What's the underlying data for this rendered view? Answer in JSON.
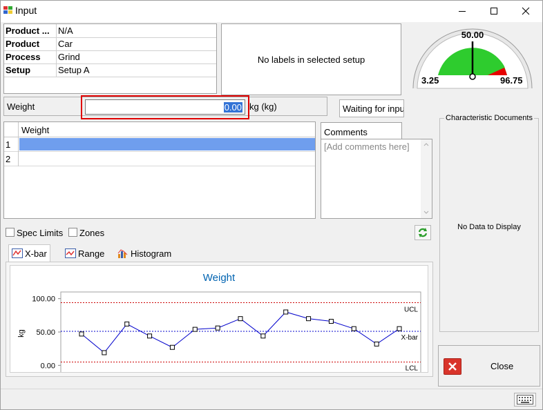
{
  "window": {
    "title": "Input"
  },
  "info": {
    "rows": [
      {
        "key": "Product ...",
        "value": "N/A"
      },
      {
        "key": "Product",
        "value": "Car"
      },
      {
        "key": "Process",
        "value": "Grind"
      },
      {
        "key": "Setup",
        "value": "Setup A"
      }
    ]
  },
  "labels_box": {
    "text": "No labels in selected setup"
  },
  "gauge": {
    "value": "50.00",
    "min": "3.25",
    "max": "96.75"
  },
  "weight_input": {
    "label": "Weight",
    "value": "0.00",
    "unit": "kg (kg)"
  },
  "status": {
    "text": "Waiting for inpu"
  },
  "grid": {
    "header": "Weight",
    "rows": [
      "1",
      "2"
    ]
  },
  "comments": {
    "tab": "Comments",
    "placeholder": "[Add comments here]"
  },
  "options": {
    "spec_limits": "Spec Limits",
    "zones": "Zones"
  },
  "tabs": {
    "xbar": "X-bar",
    "range": "Range",
    "histogram": "Histogram"
  },
  "chart_data": {
    "type": "line",
    "title": "Weight",
    "ylabel": "kg",
    "ylim": [
      -10,
      110
    ],
    "yticks": [
      "100.00",
      "50.00",
      "0.00"
    ],
    "ytick_values": [
      100,
      50,
      0
    ],
    "series": [
      {
        "values": [
          47,
          19,
          62,
          44,
          27,
          54,
          56,
          70,
          44,
          80,
          70,
          66,
          55,
          32,
          55
        ]
      }
    ],
    "limits": [
      {
        "name": "UCL",
        "value": 94,
        "color": "#cc0000"
      },
      {
        "name": "X-bar",
        "value": 51,
        "color": "#0000cc"
      },
      {
        "name": "LCL",
        "value": 5,
        "color": "#cc0000"
      }
    ]
  },
  "documents": {
    "title": "Characteristic Documents",
    "empty": "No Data to Display"
  },
  "close_button": {
    "label": "Close"
  },
  "colors": {
    "accent": "#0063b1",
    "selection": "#6f9eee",
    "gauge_green": "#2ecc2e",
    "gauge_red": "#e60000",
    "highlight_box": "#e00000"
  }
}
